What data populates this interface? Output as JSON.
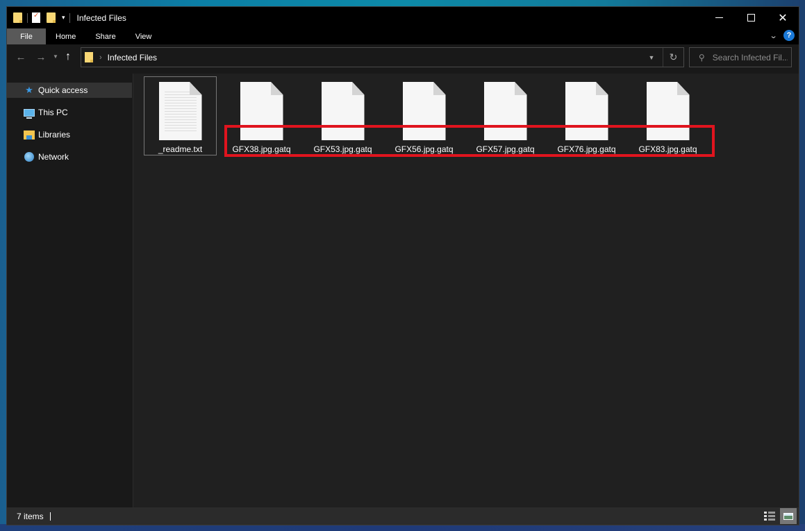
{
  "window": {
    "title": "Infected Files",
    "controls": {
      "minimize": "minimize",
      "maximize": "maximize",
      "close": "✕"
    }
  },
  "quick_access_toolbar": {
    "icons": [
      "folder-icon",
      "properties-icon",
      "new-folder-icon",
      "customize-dropdown-icon"
    ],
    "dropdown_glyph": "▾"
  },
  "ribbon": {
    "tabs": [
      {
        "label": "File",
        "active": true
      },
      {
        "label": "Home"
      },
      {
        "label": "Share"
      },
      {
        "label": "View"
      }
    ],
    "expand_glyph": "⌄",
    "help_glyph": "?"
  },
  "navigation": {
    "back_glyph": "←",
    "forward_glyph": "→",
    "recent_glyph": "⌄",
    "up_glyph": "↑",
    "address": {
      "separator": "›",
      "path": "Infected Files",
      "dropdown_glyph": "⌄",
      "refresh_glyph": "↻"
    },
    "search": {
      "placeholder": "Search Infected Fil...",
      "value": ""
    }
  },
  "sidebar": {
    "items": [
      {
        "label": "Quick access",
        "icon": "star-icon",
        "active": true
      },
      {
        "label": "This PC",
        "icon": "computer-icon"
      },
      {
        "label": "Libraries",
        "icon": "libraries-icon"
      },
      {
        "label": "Network",
        "icon": "network-icon"
      }
    ]
  },
  "files": [
    {
      "name": "_readme.txt",
      "type": "text",
      "selected": true
    },
    {
      "name": "GFX38.jpg.gatq",
      "type": "unknown"
    },
    {
      "name": "GFX53.jpg.gatq",
      "type": "unknown"
    },
    {
      "name": "GFX56.jpg.gatq",
      "type": "unknown"
    },
    {
      "name": "GFX57.jpg.gatq",
      "type": "unknown"
    },
    {
      "name": "GFX76.jpg.gatq",
      "type": "unknown"
    },
    {
      "name": "GFX83.jpg.gatq",
      "type": "unknown"
    }
  ],
  "annotation": {
    "highlight_color": "#e0141e",
    "highlights": "encrypted .gatq files"
  },
  "status_bar": {
    "item_count": "7 items",
    "views": [
      "details-view",
      "large-icons-view"
    ],
    "active_view": "large-icons-view"
  }
}
